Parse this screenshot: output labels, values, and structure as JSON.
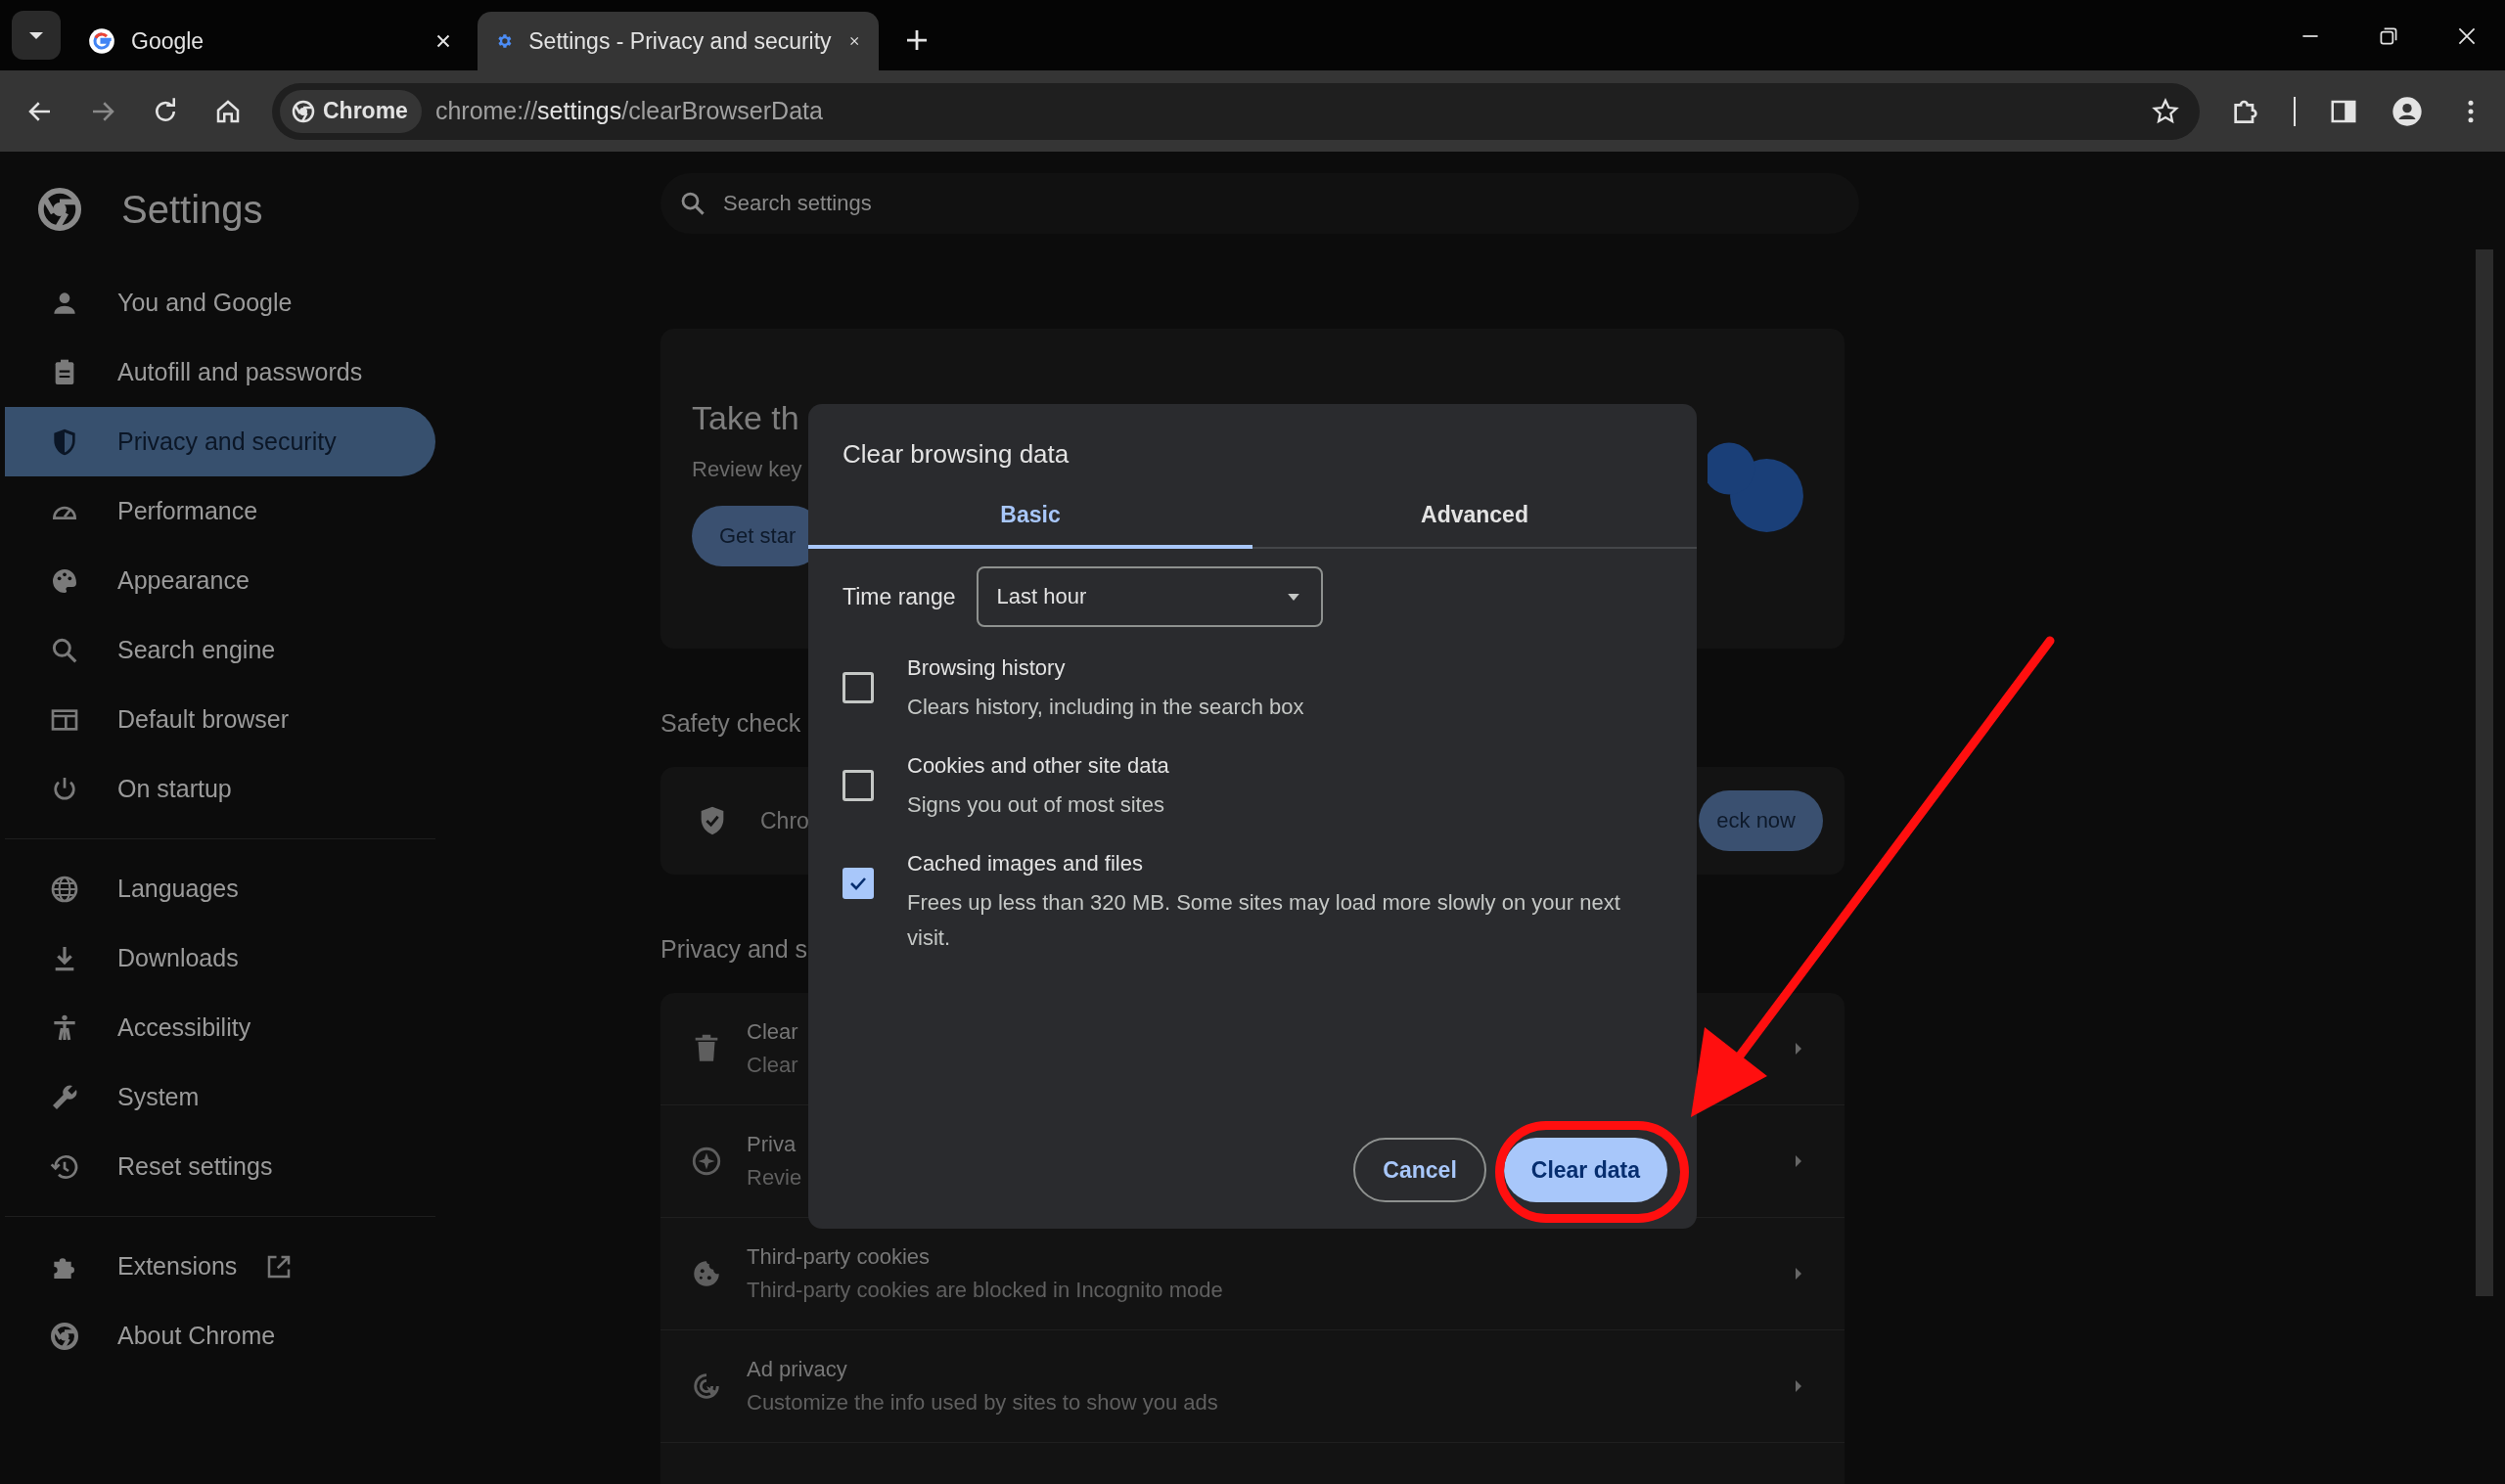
{
  "browser": {
    "tabs": [
      {
        "title": "Google",
        "selected": false
      },
      {
        "title": "Settings - Privacy and security",
        "selected": true
      }
    ],
    "address": {
      "chip": "Chrome",
      "scheme": "chrome://",
      "host": "settings",
      "path": "/clearBrowserData"
    }
  },
  "sidebar": {
    "title": "Settings",
    "sections": [
      {
        "items": [
          {
            "label": "You and Google",
            "selected": false
          },
          {
            "label": "Autofill and passwords",
            "selected": false
          },
          {
            "label": "Privacy and security",
            "selected": true
          },
          {
            "label": "Performance",
            "selected": false
          },
          {
            "label": "Appearance",
            "selected": false
          },
          {
            "label": "Search engine",
            "selected": false
          },
          {
            "label": "Default browser",
            "selected": false
          },
          {
            "label": "On startup",
            "selected": false
          }
        ]
      },
      {
        "items": [
          {
            "label": "Languages",
            "selected": false
          },
          {
            "label": "Downloads",
            "selected": false
          },
          {
            "label": "Accessibility",
            "selected": false
          },
          {
            "label": "System",
            "selected": false
          },
          {
            "label": "Reset settings",
            "selected": false
          }
        ]
      },
      {
        "items": [
          {
            "label": "Extensions",
            "selected": false
          },
          {
            "label": "About Chrome",
            "selected": false
          }
        ]
      }
    ]
  },
  "search": {
    "placeholder": "Search settings"
  },
  "hero_card": {
    "title": "Take th",
    "text": "Review key",
    "button": "Get star"
  },
  "safety_check": {
    "heading": "Safety check",
    "row_text": "Chro",
    "button": "eck now"
  },
  "privacy": {
    "heading": "Privacy and s",
    "rows": [
      {
        "title": "Clear",
        "subtitle": "Clear"
      },
      {
        "title": "Priva",
        "subtitle": "Revie"
      },
      {
        "title": "Third-party cookies",
        "subtitle": "Third-party cookies are blocked in Incognito mode"
      },
      {
        "title": "Ad privacy",
        "subtitle": "Customize the info used by sites to show you ads"
      }
    ]
  },
  "dialog": {
    "title": "Clear browsing data",
    "tabs": [
      {
        "label": "Basic",
        "selected": true
      },
      {
        "label": "Advanced",
        "selected": false
      }
    ],
    "time_range": {
      "label": "Time range",
      "value": "Last hour"
    },
    "options": [
      {
        "title": "Browsing history",
        "description": "Clears history, including in the search box",
        "checked": false
      },
      {
        "title": "Cookies and other site data",
        "description": "Signs you out of most sites",
        "checked": false
      },
      {
        "title": "Cached images and files",
        "description": "Frees up less than 320 MB. Some sites may load more slowly on your next visit.",
        "checked": true
      }
    ],
    "buttons": [
      {
        "label": "Cancel",
        "kind": "outlined"
      },
      {
        "label": "Clear data",
        "kind": "filled"
      }
    ]
  }
}
